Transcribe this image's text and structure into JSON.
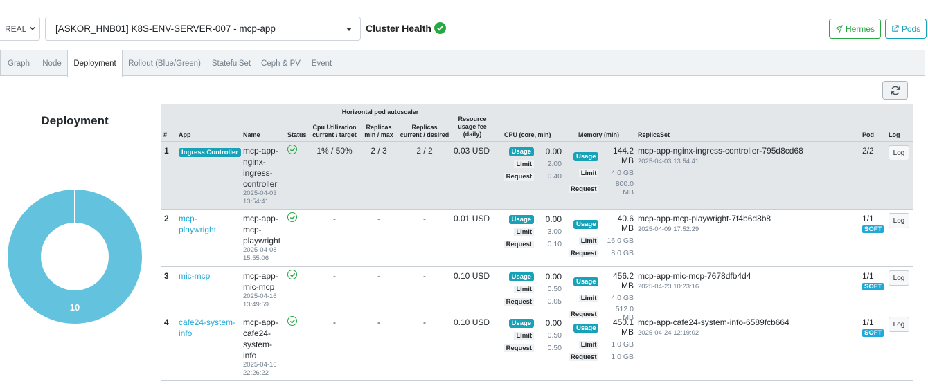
{
  "header": {
    "env_select": "REAL",
    "cluster_select": "[ASKOR_HNB01] K8S-ENV-SERVER-007 - mcp-app",
    "cluster_health_label": "Cluster Health",
    "hermes_label": "Hermes",
    "pods_label": "Pods"
  },
  "tabs": [
    "Graph",
    "Node",
    "Deployment",
    "Rollout (Blue/Green)",
    "StatefulSet",
    "Ceph & PV",
    "Event"
  ],
  "donut": {
    "title": "Deployment",
    "count": "10",
    "color": "#63c2de"
  },
  "table": {
    "headers": {
      "num": "#",
      "app": "App",
      "name": "Name",
      "status": "Status",
      "hpa_group": "Horizontal pod autoscaler",
      "cpu_util_1": "Cpu Utilization",
      "cpu_util_2": "current / target",
      "replicas_minmax_1": "Replicas",
      "replicas_minmax_2": "min / max",
      "replicas_cd_1": "Replicas",
      "replicas_cd_2": "current / desired",
      "fee_1": "Resource",
      "fee_2": "usage fee",
      "fee_3": "(daily)",
      "cpu": "CPU (core, min)",
      "memory": "Memory (min)",
      "replicaset": "ReplicaSet",
      "pod": "Pod",
      "log": "Log"
    },
    "labels": {
      "usage": "Usage",
      "limit": "Limit",
      "request": "Request",
      "log_button": "Log"
    },
    "rows": [
      {
        "num": "1",
        "app_badge": "Ingress Controller",
        "name_lines": [
          "mcp-app-",
          "nginx-",
          "ingress-",
          "controller"
        ],
        "name_date": "2025-04-03",
        "name_time": "13:54:41",
        "cpu_util": "1% / 50%",
        "replicas_minmax": "2 / 3",
        "replicas_cd": "2 / 2",
        "fee": "0.03 USD",
        "cpu_usage": "0.00",
        "cpu_limit": "2.00",
        "cpu_request": "0.40",
        "mem_usage": "144.2 MB",
        "mem_limit": "4.0 GB",
        "mem_request": "800.0 MB",
        "replicaset": "mcp-app-nginx-ingress-controller-795d8cd68",
        "replicaset_time": "2025-04-03 13:54:41",
        "pod": "2/2",
        "pod_badge": ""
      },
      {
        "num": "2",
        "app_lines": [
          "mcp-",
          "playwright"
        ],
        "name_lines": [
          "mcp-app-",
          "mcp-",
          "playwright"
        ],
        "name_date": "2025-04-08",
        "name_time": "15:55:06",
        "cpu_util": "-",
        "replicas_minmax": "-",
        "replicas_cd": "-",
        "fee": "0.01 USD",
        "cpu_usage": "0.00",
        "cpu_limit": "3.00",
        "cpu_request": "0.10",
        "mem_usage": "40.6 MB",
        "mem_limit": "16.0 GB",
        "mem_request": "8.0 GB",
        "replicaset": "mcp-app-mcp-playwright-7f4b6d8b8",
        "replicaset_time": "2025-04-09 17:52:29",
        "pod": "1/1",
        "pod_badge": "SOFT"
      },
      {
        "num": "3",
        "app_lines": [
          "mic-mcp"
        ],
        "name_lines": [
          "mcp-app-",
          "mic-mcp"
        ],
        "name_date": "2025-04-16",
        "name_time": "13:49:59",
        "cpu_util": "-",
        "replicas_minmax": "-",
        "replicas_cd": "-",
        "fee": "0.10 USD",
        "cpu_usage": "0.00",
        "cpu_limit": "0.50",
        "cpu_request": "0.05",
        "mem_usage": "456.2 MB",
        "mem_limit": "4.0 GB",
        "mem_request": "512.0 MB",
        "replicaset": "mcp-app-mic-mcp-7678dfb4d4",
        "replicaset_time": "2025-04-23 10:23:16",
        "pod": "1/1",
        "pod_badge": "SOFT"
      },
      {
        "num": "4",
        "app_lines": [
          "cafe24-system-",
          "info"
        ],
        "name_lines": [
          "mcp-app-",
          "cafe24-",
          "system-",
          "info"
        ],
        "name_date": "2025-04-16",
        "name_time": "22:26:22",
        "cpu_util": "-",
        "replicas_minmax": "-",
        "replicas_cd": "-",
        "fee": "0.10 USD",
        "cpu_usage": "0.00",
        "cpu_limit": "0.50",
        "cpu_request": "0.50",
        "mem_usage": "450.1 MB",
        "mem_limit": "1.0 GB",
        "mem_request": "1.0 GB",
        "replicaset": "mcp-app-cafe24-system-info-6589fcb664",
        "replicaset_time": "2025-04-24 12:19:02",
        "pod": "1/1",
        "pod_badge": "SOFT"
      }
    ]
  }
}
